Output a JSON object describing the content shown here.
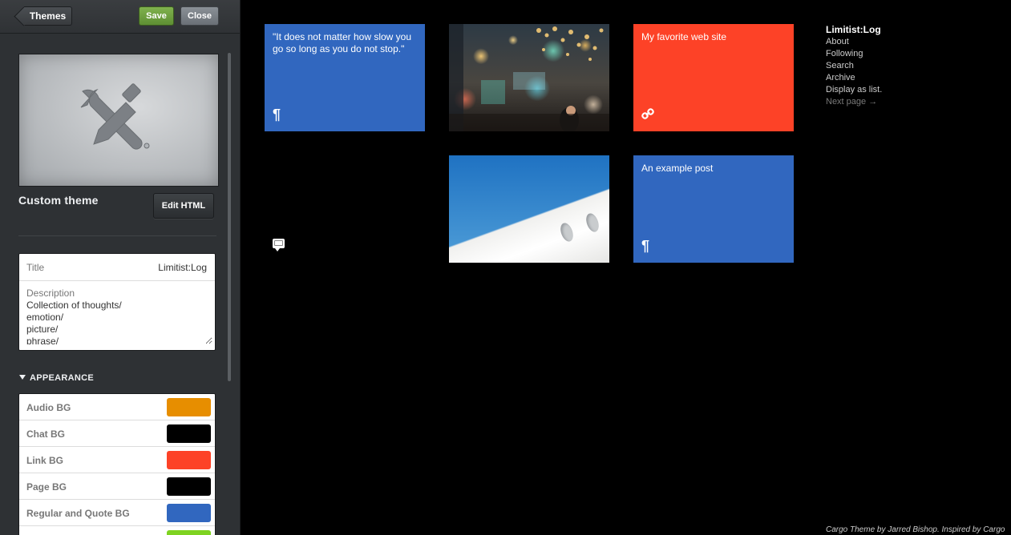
{
  "toolbar": {
    "themes_label": "Themes",
    "save_label": "Save",
    "close_label": "Close"
  },
  "theme": {
    "name": "Custom theme",
    "edit_html_label": "Edit HTML"
  },
  "info": {
    "title_label": "Title",
    "title_value": "Limitist:Log",
    "description_label": "Description",
    "description_value": "Collection of thoughts/\nemotion/\npicture/\nphrase/"
  },
  "appearance": {
    "section_label": "APPEARANCE",
    "colors": [
      {
        "label": "Audio BG",
        "color": "#e78e00"
      },
      {
        "label": "Chat BG",
        "color": "#000000"
      },
      {
        "label": "Link BG",
        "color": "#fd4227"
      },
      {
        "label": "Page BG",
        "color": "#000000"
      },
      {
        "label": "Regular and Quote BG",
        "color": "#3167bf"
      },
      {
        "label": "",
        "color": "#7ed321"
      }
    ]
  },
  "posts": {
    "quote_text": "\"It does not matter how slow you go so long as you do not stop.\"",
    "quote_icon": "¶",
    "link_text": "My favorite web site",
    "link_icon": "link-icon",
    "example_text": "An example post",
    "example_icon": "¶",
    "chat_icon": "chat-bubble-icon"
  },
  "nav": {
    "blog_title": "Limitist:Log",
    "about": "About",
    "following": "Following",
    "search": "Search",
    "archive": "Archive",
    "display_as_list": "Display as list.",
    "next_page": "Next page →"
  },
  "footer": {
    "credit": "Cargo Theme by Jarred Bishop. Inspired by Cargo"
  },
  "colors": {
    "blue_post": "#3167bf",
    "red_post": "#fd4227",
    "save_green": "#6a9b3a",
    "sidebar_bg": "#2e3134"
  }
}
